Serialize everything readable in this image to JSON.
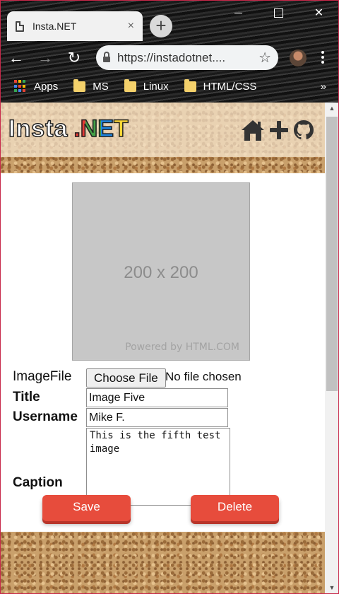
{
  "browser": {
    "tab_title": "Insta.NET",
    "tab_close": "×",
    "new_tab": "+",
    "url": "https://instadotnet....",
    "back": "←",
    "forward": "→",
    "reload": "↻",
    "star": "☆",
    "bookmarks": [
      {
        "label": "Apps",
        "icon": "apps-grid-icon"
      },
      {
        "label": "MS",
        "icon": "folder-icon"
      },
      {
        "label": "Linux",
        "icon": "folder-icon"
      },
      {
        "label": "HTML/CSS",
        "icon": "folder-icon"
      }
    ],
    "bookmarks_more": "»",
    "window_close": "✕"
  },
  "site": {
    "logo_insta": "Insta",
    "logo_net": ".NET",
    "nav_icons": [
      "home-icon",
      "plus-icon",
      "github-icon"
    ],
    "accent_color": "#e74c3c"
  },
  "placeholder": {
    "dims": "200 x 200",
    "powered": "Powered by HTML.COM"
  },
  "form": {
    "image_file_label": "ImageFile",
    "choose_file": "Choose File",
    "file_status": "No file chosen",
    "title_label": "Title",
    "title_value": "Image Five",
    "username_label": "Username",
    "username_value": "Mike F.",
    "caption_label": "Caption",
    "caption_value": "This is the fifth test image",
    "save": "Save",
    "delete": "Delete"
  }
}
